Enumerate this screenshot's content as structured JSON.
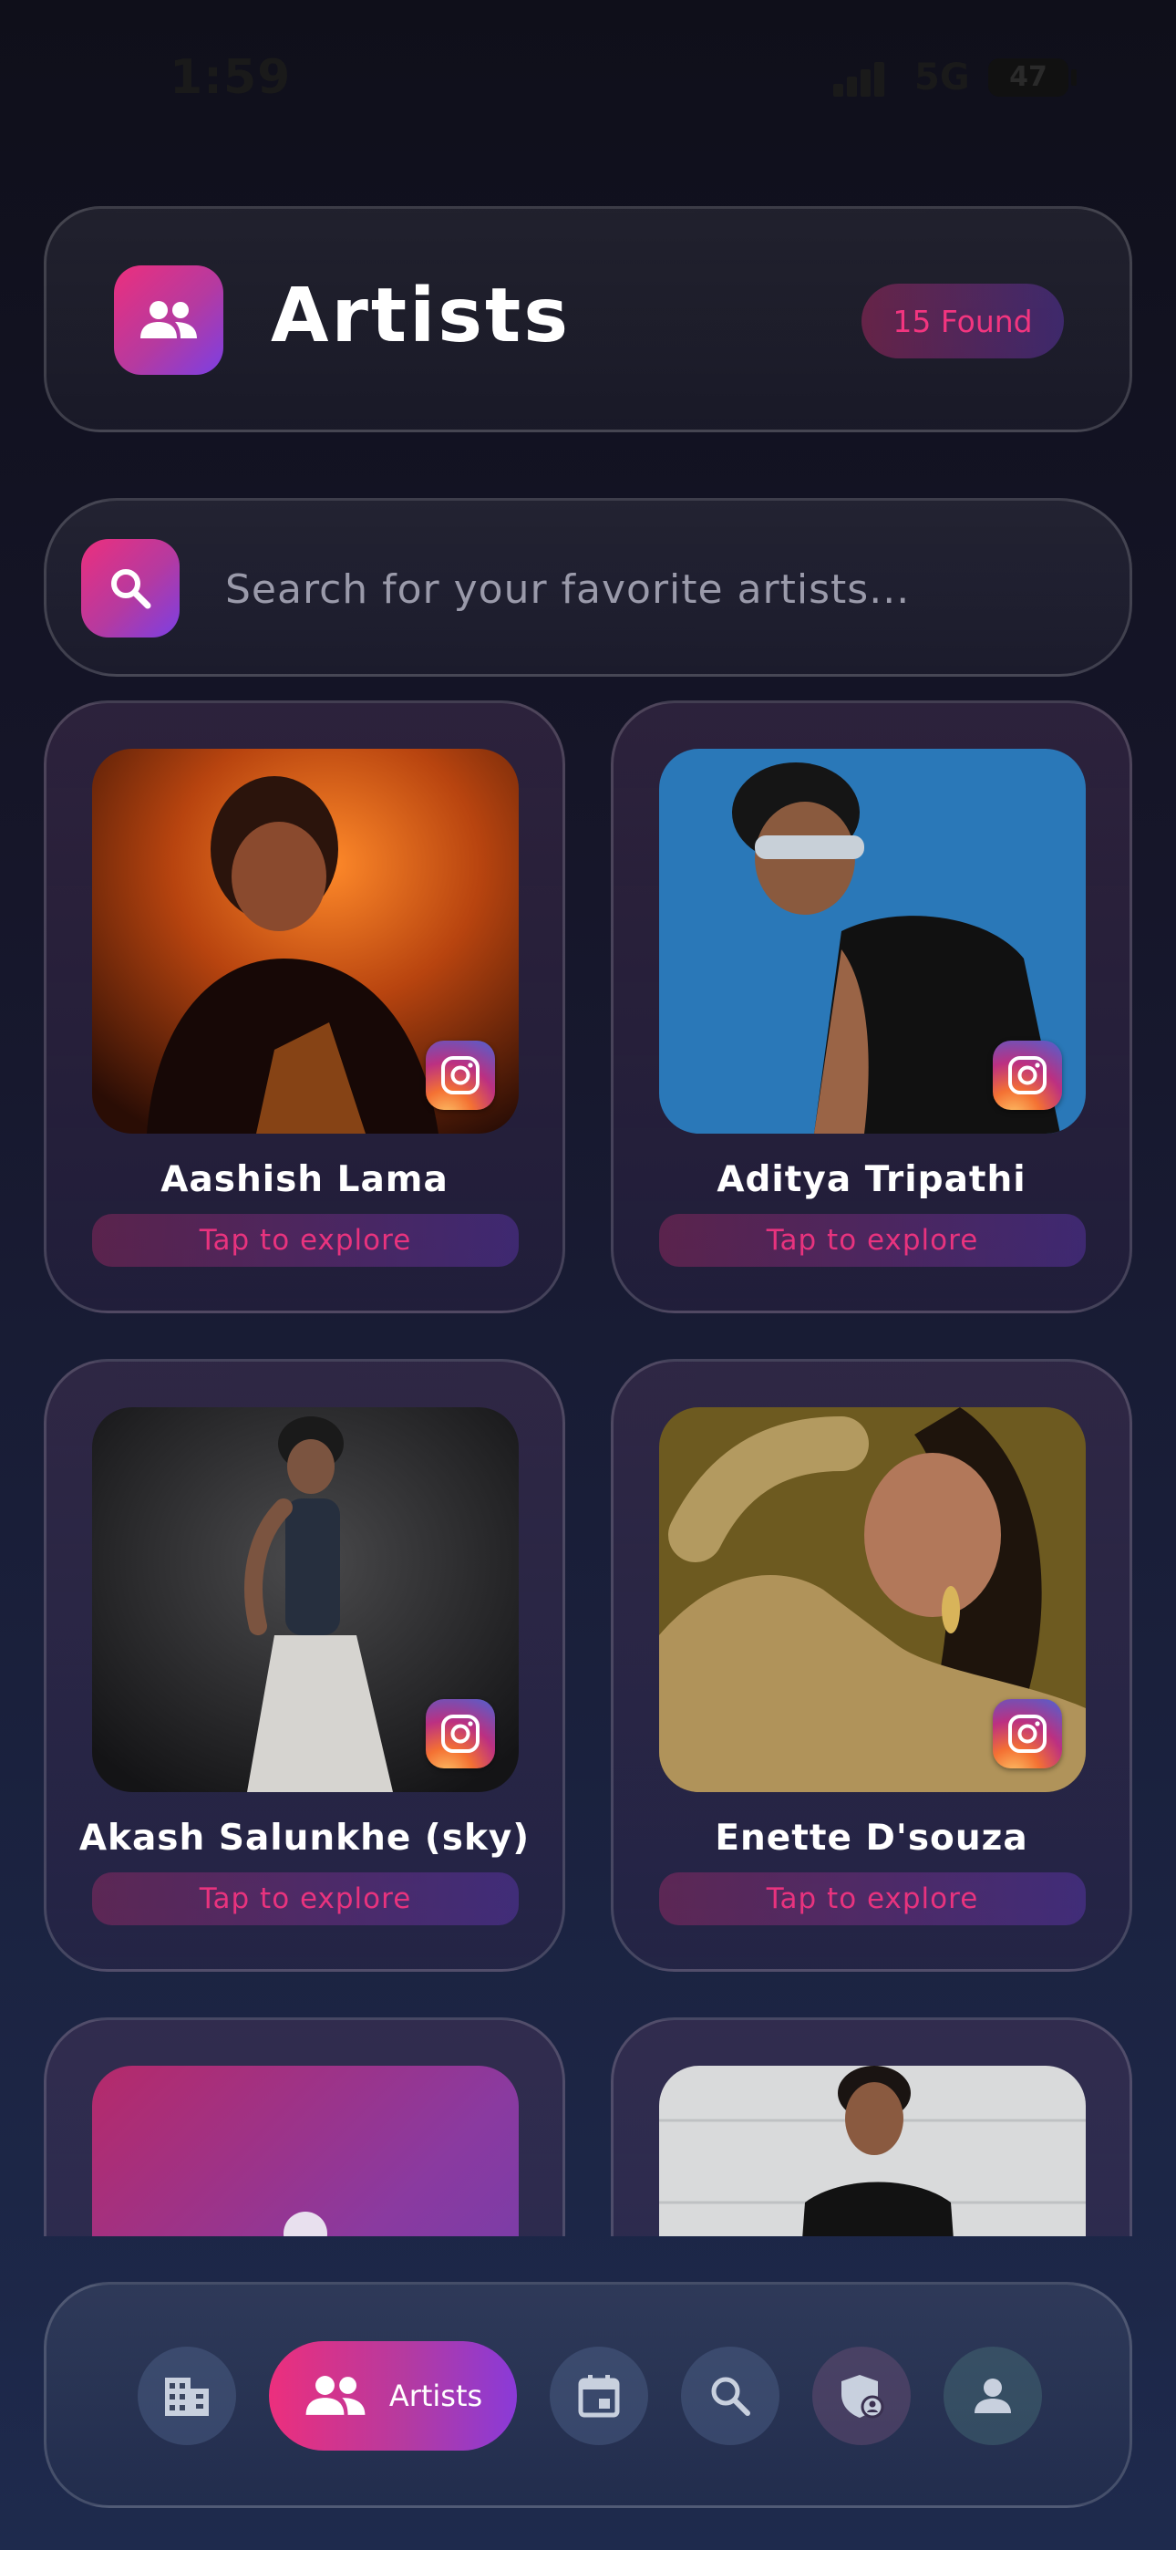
{
  "status_bar": {
    "time": "1:59",
    "network": "5G",
    "battery": "47"
  },
  "header": {
    "title": "Artists",
    "found_badge": "15 Found"
  },
  "search": {
    "placeholder": "Search for your favorite artists..."
  },
  "artists": [
    {
      "name": "Aashish Lama",
      "action": "Tap to explore"
    },
    {
      "name": "Aditya Tripathi",
      "action": "Tap to explore"
    },
    {
      "name": "Akash Salunkhe (sky)",
      "action": "Tap to explore"
    },
    {
      "name": "Enette D'souza",
      "action": "Tap to explore"
    }
  ],
  "nav": {
    "items": [
      {
        "icon": "building-icon"
      },
      {
        "icon": "people-icon",
        "label": "Artists"
      },
      {
        "icon": "calendar-icon"
      },
      {
        "icon": "search-icon"
      },
      {
        "icon": "shield-user-icon"
      },
      {
        "icon": "person-icon"
      }
    ]
  },
  "colors": {
    "accent_pink": "#ec2f7d",
    "accent_purple": "#7b3fe4"
  }
}
